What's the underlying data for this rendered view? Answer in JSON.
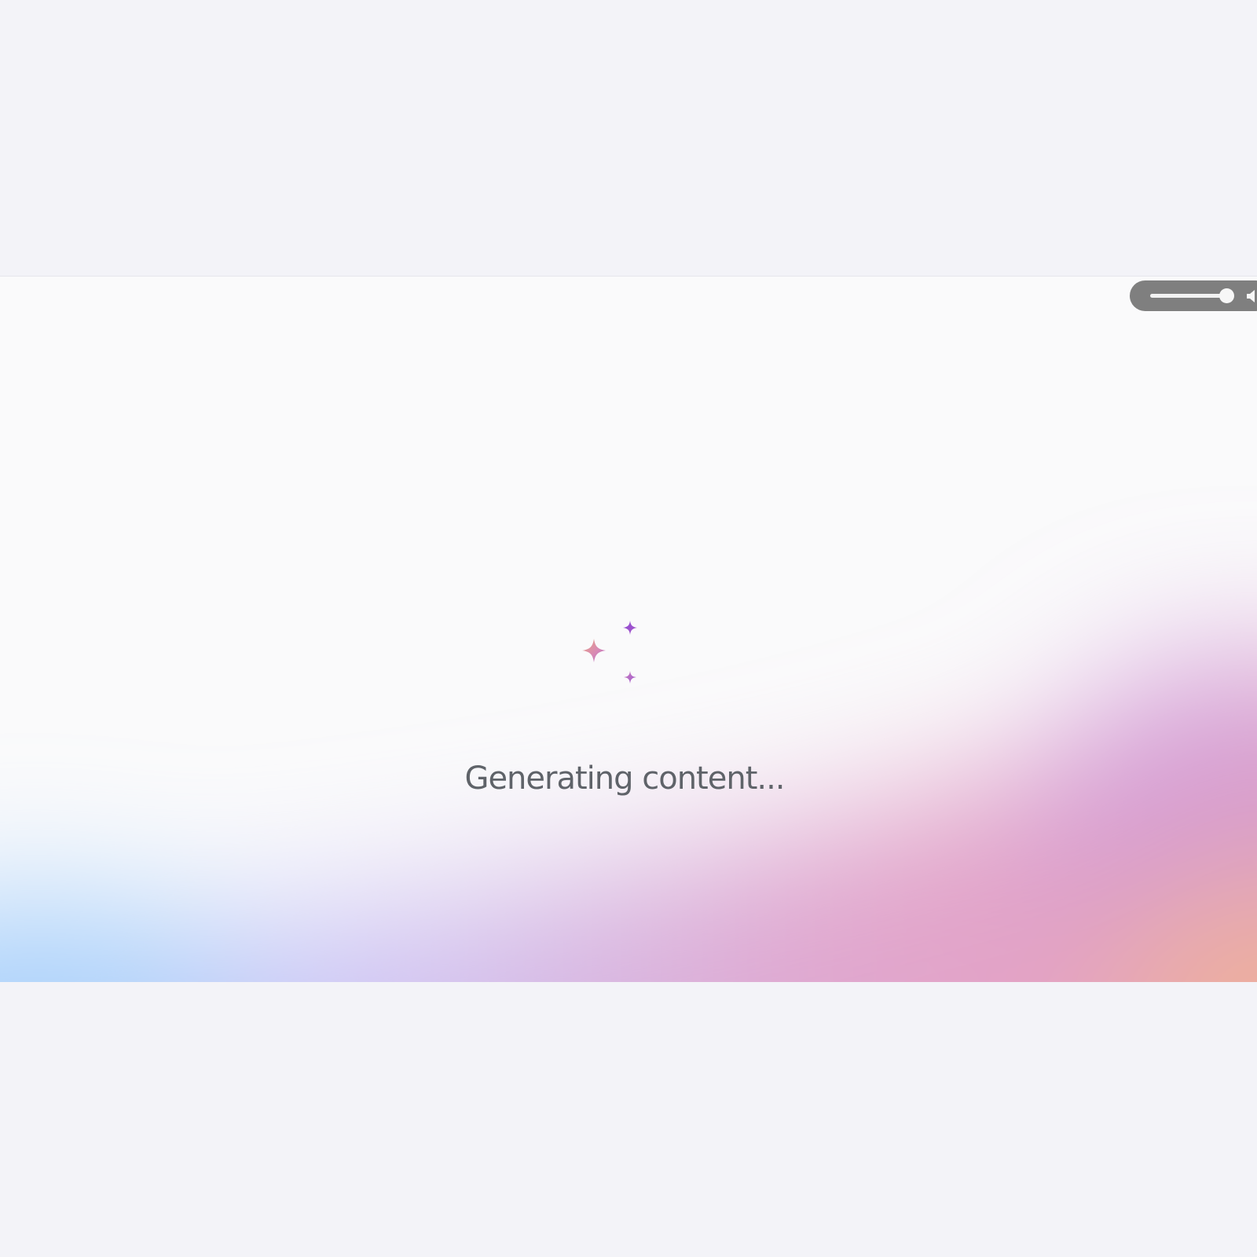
{
  "status": {
    "message": "Generating content..."
  },
  "icons": {
    "sparkles": "sparkles-icon",
    "speaker": "speaker-icon"
  },
  "volume": {
    "level": 0.92
  },
  "colors": {
    "page_background": "#f3f3f8",
    "stage_background": "#fafafb",
    "text": "#5f6369",
    "sparkle_purple": "#9b4fd1",
    "sparkle_pink": "#d98bb3",
    "sparkle_peach": "#e9a37f",
    "gradient_blue": "#a9d2fb",
    "gradient_lavender": "#cfc8f6",
    "gradient_pink": "#e0a7cf",
    "gradient_orange": "#f0b196",
    "control_gray": "#7f7f7f"
  }
}
